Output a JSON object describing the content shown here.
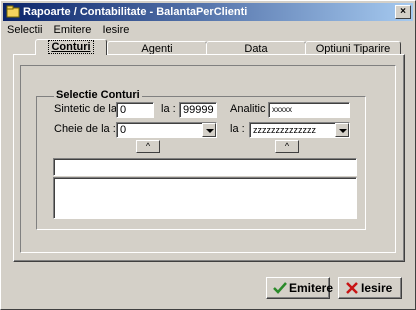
{
  "window": {
    "title": "Rapoarte / Contabilitate - BalantaPerClienti",
    "close_glyph": "×"
  },
  "menu": [
    "Selectii",
    "Emitere",
    "Iesire"
  ],
  "tabs": [
    "Conturi",
    "Agenti",
    "Data",
    "Optiuni Tiparire"
  ],
  "group": {
    "title": "Selectie Conturi",
    "sintetic_label": "Sintetic  de la :",
    "sintetic_from": "0",
    "la_label_1": "la :",
    "sintetic_to": "99999",
    "analitic_label": "Analitic :",
    "analitic_value": "xxxxx",
    "cheie_label": "Cheie de la :",
    "cheie_from": "0",
    "la_label_2": "la :",
    "cheie_to": "zzzzzzzzzzzzzz",
    "up_glyph": "^"
  },
  "buttons": {
    "emitere": "Emitere",
    "iesire": "Iesire"
  },
  "colors": {
    "face": "#d4d0c8",
    "title_start": "#0a246a",
    "title_end": "#a6caf0",
    "ok_green": "#2a8a2a",
    "cancel_red": "#c81414"
  }
}
